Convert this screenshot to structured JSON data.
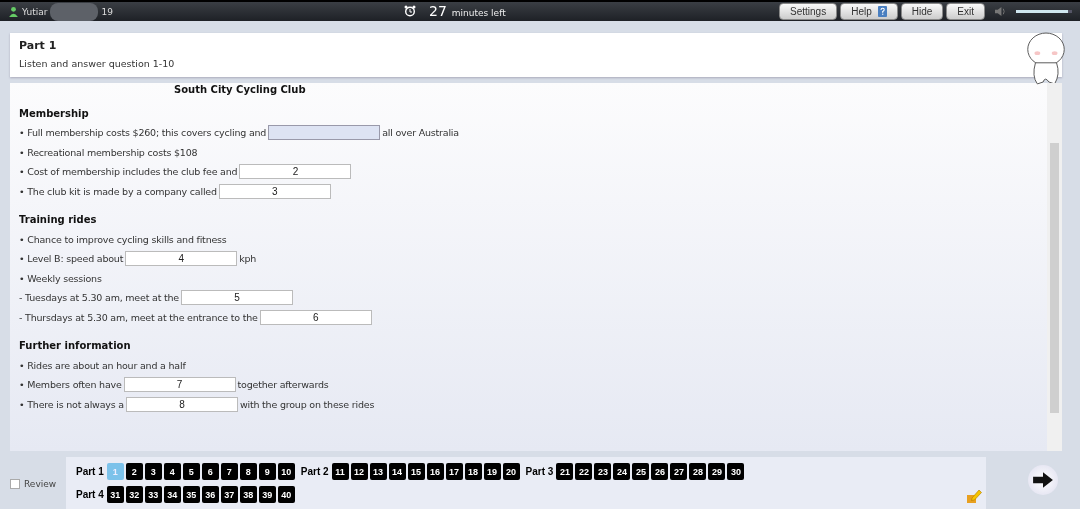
{
  "top_bar": {
    "user": "Yutiar",
    "user_suffix": "19",
    "time": "27",
    "time_label": "minutes left",
    "buttons": [
      {
        "label": "Settings",
        "kind": "plain"
      },
      {
        "label": "Help",
        "kind": "help"
      },
      {
        "label": "Hide",
        "kind": "plain"
      },
      {
        "label": "Exit",
        "kind": "plain"
      }
    ],
    "volume": {
      "level": 0.93
    }
  },
  "header": {
    "title": "Part 1",
    "instruction": "Listen and answer question 1-10"
  },
  "content": {
    "title": "South City Cycling Club",
    "sections": [
      {
        "heading": "Membership",
        "lines": [
          [
            {
              "kind": "text",
              "text": "• Full membership costs $260; this covers cycling and"
            },
            {
              "kind": "field",
              "focused": true
            },
            {
              "kind": "text",
              "text": "all over Australia"
            }
          ],
          [
            {
              "kind": "text",
              "text": "• Recreational membership costs $108"
            }
          ],
          [
            {
              "kind": "text",
              "text": "• Cost of membership includes the club fee and"
            },
            {
              "kind": "field",
              "focused": false,
              "placeholder": "2"
            }
          ],
          [
            {
              "kind": "text",
              "text": "• The club kit is made by a company called"
            },
            {
              "kind": "field",
              "focused": false,
              "placeholder": "3"
            }
          ]
        ]
      },
      {
        "heading": "Training rides",
        "lines": [
          [
            {
              "kind": "text",
              "text": "• Chance to improve cycling skills and fitness"
            }
          ],
          [
            {
              "kind": "text",
              "text": "• Level B: speed about"
            },
            {
              "kind": "field",
              "focused": false,
              "placeholder": "4"
            },
            {
              "kind": "text",
              "text": "kph"
            }
          ],
          [
            {
              "kind": "text",
              "text": "• Weekly sessions"
            }
          ],
          [
            {
              "kind": "text",
              "text": "- Tuesdays at 5.30 am, meet at the"
            },
            {
              "kind": "field",
              "focused": false,
              "placeholder": "5"
            }
          ],
          [
            {
              "kind": "text",
              "text": "- Thursdays at 5.30 am, meet at the entrance to the"
            },
            {
              "kind": "field",
              "focused": false,
              "placeholder": "6"
            }
          ]
        ]
      },
      {
        "heading": "Further information",
        "lines": [
          [
            {
              "kind": "text",
              "text": "• Rides are about an hour and a half"
            }
          ],
          [
            {
              "kind": "text",
              "text": "• Members often have"
            },
            {
              "kind": "field",
              "focused": false,
              "placeholder": "7"
            },
            {
              "kind": "text",
              "text": "together afterwards"
            }
          ],
          [
            {
              "kind": "text",
              "text": "• There is not always a"
            },
            {
              "kind": "field",
              "focused": false,
              "placeholder": "8"
            },
            {
              "kind": "text",
              "text": "with the group on these rides"
            }
          ]
        ]
      }
    ]
  },
  "navigation": {
    "review": {
      "label": "Review",
      "checked": false
    },
    "parts": [
      {
        "label": "Part 1",
        "questions": [
          {
            "number": "1",
            "selected": true
          },
          {
            "number": "2",
            "selected": false
          },
          {
            "number": "3",
            "selected": false
          },
          {
            "number": "4",
            "selected": false
          },
          {
            "number": "5",
            "selected": false
          },
          {
            "number": "6",
            "selected": false
          },
          {
            "number": "7",
            "selected": false
          },
          {
            "number": "8",
            "selected": false
          },
          {
            "number": "9",
            "selected": false
          },
          {
            "number": "10",
            "selected": false
          }
        ]
      },
      {
        "label": "Part 2",
        "questions": [
          {
            "number": "11",
            "selected": false
          },
          {
            "number": "12",
            "selected": false
          },
          {
            "number": "13",
            "selected": false
          },
          {
            "number": "14",
            "selected": false
          },
          {
            "number": "15",
            "selected": false
          },
          {
            "number": "16",
            "selected": false
          },
          {
            "number": "17",
            "selected": false
          },
          {
            "number": "18",
            "selected": false
          },
          {
            "number": "19",
            "selected": false
          },
          {
            "number": "20",
            "selected": false
          }
        ]
      },
      {
        "label": "Part 3",
        "questions": [
          {
            "number": "21",
            "selected": false
          },
          {
            "number": "22",
            "selected": false
          },
          {
            "number": "23",
            "selected": false
          },
          {
            "number": "24",
            "selected": false
          },
          {
            "number": "25",
            "selected": false
          },
          {
            "number": "26",
            "selected": false
          },
          {
            "number": "27",
            "selected": false
          },
          {
            "number": "28",
            "selected": false
          },
          {
            "number": "29",
            "selected": false
          },
          {
            "number": "30",
            "selected": false
          }
        ]
      },
      {
        "label": "Part 4",
        "questions": [
          {
            "number": "31",
            "selected": false
          },
          {
            "number": "32",
            "selected": false
          },
          {
            "number": "33",
            "selected": false
          },
          {
            "number": "34",
            "selected": false
          },
          {
            "number": "35",
            "selected": false
          },
          {
            "number": "36",
            "selected": false
          },
          {
            "number": "37",
            "selected": false
          },
          {
            "number": "38",
            "selected": false
          },
          {
            "number": "39",
            "selected": false
          },
          {
            "number": "40",
            "selected": false
          }
        ]
      }
    ]
  }
}
